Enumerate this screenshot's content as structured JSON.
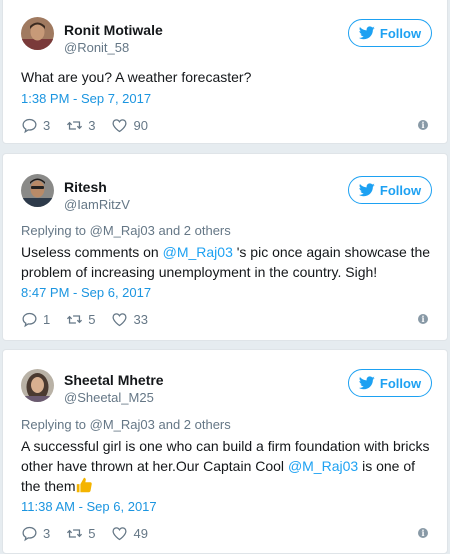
{
  "tweets": [
    {
      "name": "Ronit Motiwale",
      "handle": "@Ronit_58",
      "follow_label": "Follow",
      "replying_to": "",
      "text_parts": [
        "What are you? A weather forecaster?"
      ],
      "timestamp": "1:38 PM - Sep 7, 2017",
      "replies": "3",
      "retweets": "3",
      "likes": "90"
    },
    {
      "name": "Ritesh",
      "handle": "@IamRitzV",
      "follow_label": "Follow",
      "replying_to": "Replying to @M_Raj03 and 2 others",
      "text_before": "Useless comments on ",
      "mention": "@M_Raj03",
      "text_after": " 's pic once again showcase the problem of increasing unemployment in the country. Sigh!",
      "timestamp": "8:47 PM - Sep 6, 2017",
      "replies": "1",
      "retweets": "5",
      "likes": "33"
    },
    {
      "name": "Sheetal Mhetre",
      "handle": "@Sheetal_M25",
      "follow_label": "Follow",
      "replying_to": "Replying to @M_Raj03 and 2 others",
      "text_before": "A successful girl is one who can build a firm foundation with bricks other have thrown at her.Our Captain Cool ",
      "mention": "@M_Raj03",
      "text_after": " is one of the them",
      "timestamp": "11:38 AM - Sep 6, 2017",
      "replies": "3",
      "retweets": "5",
      "likes": "49"
    }
  ],
  "colors": {
    "accent": "#1da1f2",
    "timestamp": "#1b95e0",
    "muted": "#657786",
    "background": "#e6ecf0"
  },
  "icons": [
    "twitter-bird-icon",
    "reply-icon",
    "retweet-icon",
    "like-icon",
    "info-icon",
    "thumbs-up-emoji-icon"
  ]
}
